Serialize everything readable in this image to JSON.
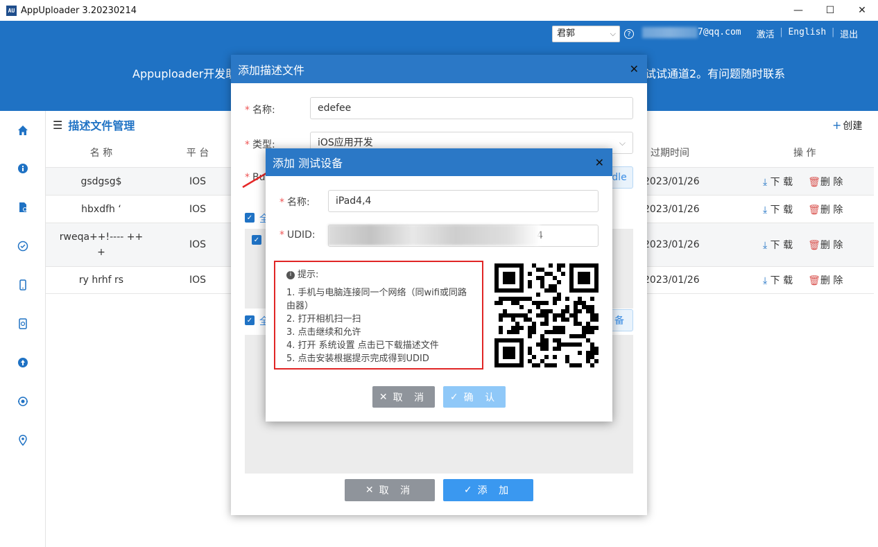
{
  "window": {
    "title": "AppUploader 3.20230214",
    "icon_text": "AU",
    "minimize": "—",
    "maximize": "☐",
    "close": "✕"
  },
  "header": {
    "user_select": "君郭",
    "email_suffix": "7@qq.com",
    "activate": "激活",
    "english": "English",
    "logout": "退出",
    "banner_left": "Appuploader开发助",
    "banner_right": "试试通道2。有问题随时联系"
  },
  "main": {
    "title": "描述文件管理",
    "create": "创建",
    "columns": {
      "name": "名 称",
      "platform": "平 台",
      "expiry": "过期时间",
      "actions": "操 作"
    },
    "download": "下 载",
    "delete": "删 除",
    "rows": [
      {
        "name": "gsdgsg$",
        "platform": "IOS",
        "expiry": "2023/01/26"
      },
      {
        "name": "hbxdfh ‘",
        "platform": "IOS",
        "expiry": "2023/01/26"
      },
      {
        "name": "rweqa++!---- ++",
        "name2": "+",
        "platform": "IOS",
        "expiry": "2023/01/26"
      },
      {
        "name": "ry hrhf rs",
        "platform": "IOS",
        "expiry": "2023/01/26"
      }
    ]
  },
  "dialog_profile": {
    "title": "添加描述文件",
    "name_label": "名称:",
    "name_value": "edefee",
    "type_label": "类型:",
    "type_value": "iOS应用开发",
    "bundle_label": "Bur",
    "bundle_btn": "dle",
    "all_label_1": "全",
    "all_label_2": "全",
    "device_btn": "备",
    "cancel": "取 消",
    "add": "添 加"
  },
  "dialog_device": {
    "title": "添加 测试设备",
    "name_label": "名称:",
    "name_value": "iPad4,4",
    "udid_label": "UDID:",
    "udid_tail": "4",
    "tips_title": "提示:",
    "tips": [
      "1. 手机与电脑连接同一个网络（同wifi或同路",
      "由器）",
      "2. 打开相机扫一扫",
      "3. 点击继续和允许",
      "4. 打开 系统设置 点击已下载描述文件",
      "5. 点击安装根据提示完成得到UDID"
    ],
    "cancel": "取 消",
    "confirm": "确 认"
  },
  "colors": {
    "header_blue": "#1f72c4",
    "tips_border": "#e02525",
    "confirm_light": "#8fc8f8"
  }
}
